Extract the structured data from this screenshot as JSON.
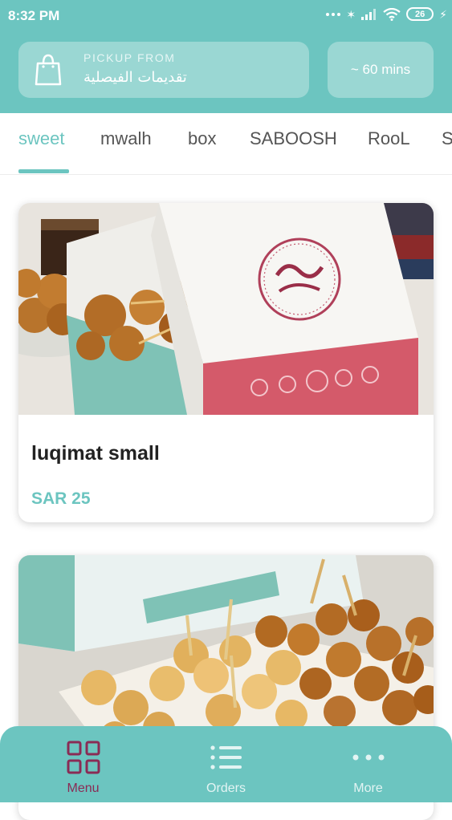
{
  "status_bar": {
    "time": "8:32 PM",
    "battery": "26"
  },
  "header": {
    "pickup_label": "PICKUP FROM",
    "store_name": "تقديمات الفيصلية",
    "eta": "~ 60 mins"
  },
  "tabs": [
    {
      "label": "sweet",
      "active": true
    },
    {
      "label": "mwalh"
    },
    {
      "label": "box"
    },
    {
      "label": "SABOOSH"
    },
    {
      "label": "RooL"
    },
    {
      "label": "S"
    }
  ],
  "products": [
    {
      "name": "luqimat small",
      "price": "SAR 25",
      "image": "luqaimat-box-photo"
    },
    {
      "image": "luqaimat-tray-photo"
    }
  ],
  "bottom_nav": [
    {
      "label": "Menu",
      "icon": "grid-icon",
      "active": true
    },
    {
      "label": "Orders",
      "icon": "list-icon"
    },
    {
      "label": "More",
      "icon": "more-dots-icon"
    }
  ],
  "colors": {
    "accent": "#6cc5c0",
    "active_nav": "#8a2b55"
  }
}
